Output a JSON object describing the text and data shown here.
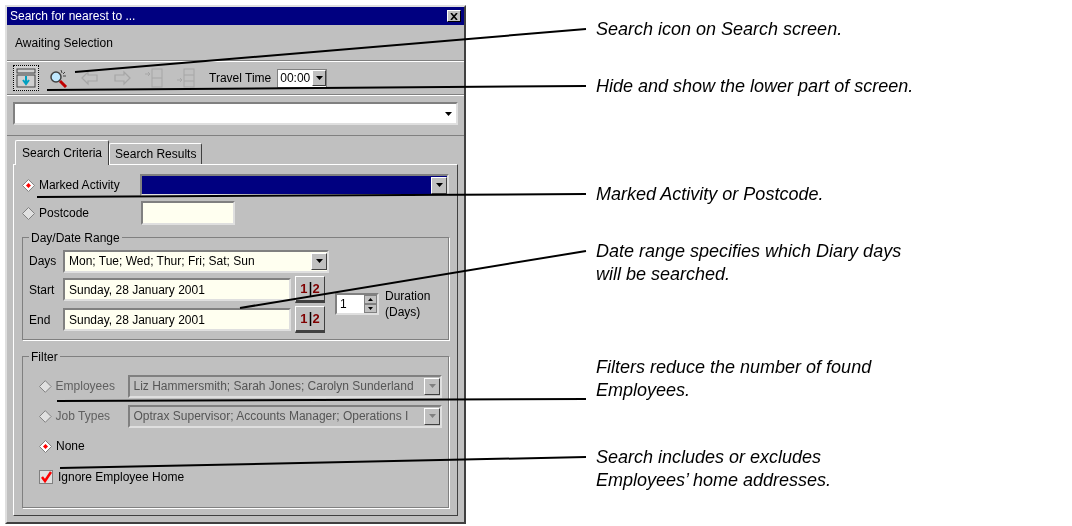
{
  "window": {
    "title": "Search for nearest to ..."
  },
  "status": "Awaiting Selection",
  "toolbar": [
    {
      "kind": "collapse",
      "disabled": false
    },
    {
      "kind": "search",
      "disabled": false
    },
    {
      "kind": "back",
      "disabled": true
    },
    {
      "kind": "forward",
      "disabled": true
    },
    {
      "kind": "panel-in",
      "disabled": true
    },
    {
      "kind": "panel-out",
      "disabled": true
    }
  ],
  "travel_time": {
    "label": "Travel Time",
    "value": "00:00"
  },
  "tabs": [
    {
      "label": "Search Criteria",
      "selected": true
    },
    {
      "label": "Search Results",
      "selected": false
    }
  ],
  "source": [
    {
      "label": "Marked Activity",
      "selected": true,
      "kind": "combo"
    },
    {
      "label": "Postcode",
      "selected": false,
      "kind": "text"
    }
  ],
  "date_range": {
    "title": "Day/Date Range",
    "days_label": "Days",
    "days": "Mon; Tue; Wed; Thur; Fri; Sat; Sun",
    "dates": [
      {
        "label": "Start",
        "value": "Sunday, 28 January 2001",
        "digits": [
          "1",
          "2"
        ]
      },
      {
        "label": "End",
        "value": "Sunday, 28 January 2001",
        "digits": [
          "1",
          "2"
        ]
      }
    ],
    "duration": {
      "value": "1",
      "label": "Duration (Days)"
    }
  },
  "filter": {
    "title": "Filter",
    "options": [
      {
        "label": "Employees",
        "value": "Liz Hammersmith; Sarah Jones; Carolyn Sunderland",
        "selected": false,
        "disabled": true
      },
      {
        "label": "Job Types",
        "value": "Optrax Supervisor; Accounts Manager; Operations I",
        "selected": false,
        "disabled": true
      },
      {
        "label": "None",
        "selected": true
      }
    ],
    "ignore_home": {
      "label": "Ignore Employee Home",
      "checked": true
    }
  },
  "callouts": [
    {
      "lines": [
        "Search icon on Search screen."
      ]
    },
    {
      "lines": [
        "Hide and show the lower part of screen."
      ]
    },
    {
      "lines": [
        "Marked Activity or Postcode."
      ]
    },
    {
      "lines": [
        "Date range specifies which Diary days",
        "will be searched."
      ]
    },
    {
      "lines": [
        "Filters reduce the number of found",
        "Employees."
      ]
    },
    {
      "lines": [
        "Search includes or excludes",
        "Employees’ home addresses."
      ]
    }
  ]
}
